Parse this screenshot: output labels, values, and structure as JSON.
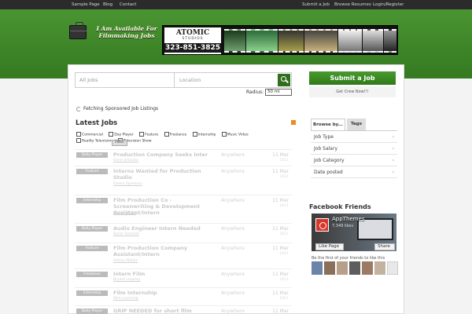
{
  "topnav": {
    "left": [
      "Sample Page",
      "Blog",
      "Contact"
    ],
    "right": [
      "Submit a Job",
      "Browse Resumes",
      "Login/Register"
    ]
  },
  "logo": {
    "text": "I Am Available For Filmmaking Jobs"
  },
  "banner": {
    "brand": "ATOMIC",
    "sub": "STUDIOS",
    "phone": "323-851-3825"
  },
  "search": {
    "keywords_placeholder": "All Jobs",
    "location_placeholder": "Location",
    "radius_label": "Radius:",
    "radius_value": "50 mi"
  },
  "fetching": "Fetching Sponsored Job Listings",
  "latest_title": "Latest Jobs",
  "filters": [
    "Commercial",
    "Day Player",
    "Feature",
    "Freelance",
    "Internship",
    "Music Video",
    "Reality Television",
    "Television Show"
  ],
  "filter_button": "Filter",
  "jobs": [
    {
      "type": "Daily Player",
      "title": "Production Company Seeks Inter",
      "company": "Gene Srikanta",
      "location": "Anywhere",
      "date": "11 Mar",
      "year": "2011"
    },
    {
      "type": "Feature",
      "title": "Interns Wanted for Production Studio",
      "company": "Fidelio Spielman",
      "location": "Anywhere",
      "date": "11 Mar",
      "year": "2011"
    },
    {
      "type": "Internship",
      "title": "Film Production Co - Screenwriting & Development Assistant/Intern",
      "company": "Carlos Shake",
      "location": "Anywhere",
      "date": "11 Mar",
      "year": "2011"
    },
    {
      "type": "Daily Player",
      "title": "Audio Engineer Intern Needed",
      "company": "Dollar Rutshell",
      "location": "Anywhere",
      "date": "11 Mar",
      "year": "2011"
    },
    {
      "type": "Feature",
      "title": "Film Production Company Assistant/Intern",
      "company": "Ashley Mobile",
      "location": "Anywhere",
      "date": "11 Mar",
      "year": "2011"
    },
    {
      "type": "Freelance",
      "title": "Intern Film",
      "company": "Bryant Looping",
      "location": "Anywhere",
      "date": "11 Mar",
      "year": "2011"
    },
    {
      "type": "Internship",
      "title": "Film Internship",
      "company": "Mimi Lovering",
      "location": "Anywhere",
      "date": "11 Mar",
      "year": "2011"
    },
    {
      "type": "Daily Player",
      "title": "GRIP NEEDED for short film",
      "company": "",
      "location": "Anywhere",
      "date": "11 Mar",
      "year": ""
    }
  ],
  "sidebar": {
    "submit": "Submit a Job",
    "crew": "Get Crew Now!!!",
    "tabs": [
      "Browse by...",
      "Tags"
    ],
    "browse": [
      "Job Type",
      "Job Salary",
      "Job Category",
      "Date posted"
    ],
    "fb_title": "Facebook Friends",
    "fb_name": "AppThemes",
    "fb_likes": "7,349 likes",
    "fb_like": "Like Page",
    "fb_share": "Share",
    "fb_first": "Be the first of your friends to like this"
  },
  "colors": {
    "brand_green": "#3e8528",
    "dark": "#2b2b2b"
  }
}
